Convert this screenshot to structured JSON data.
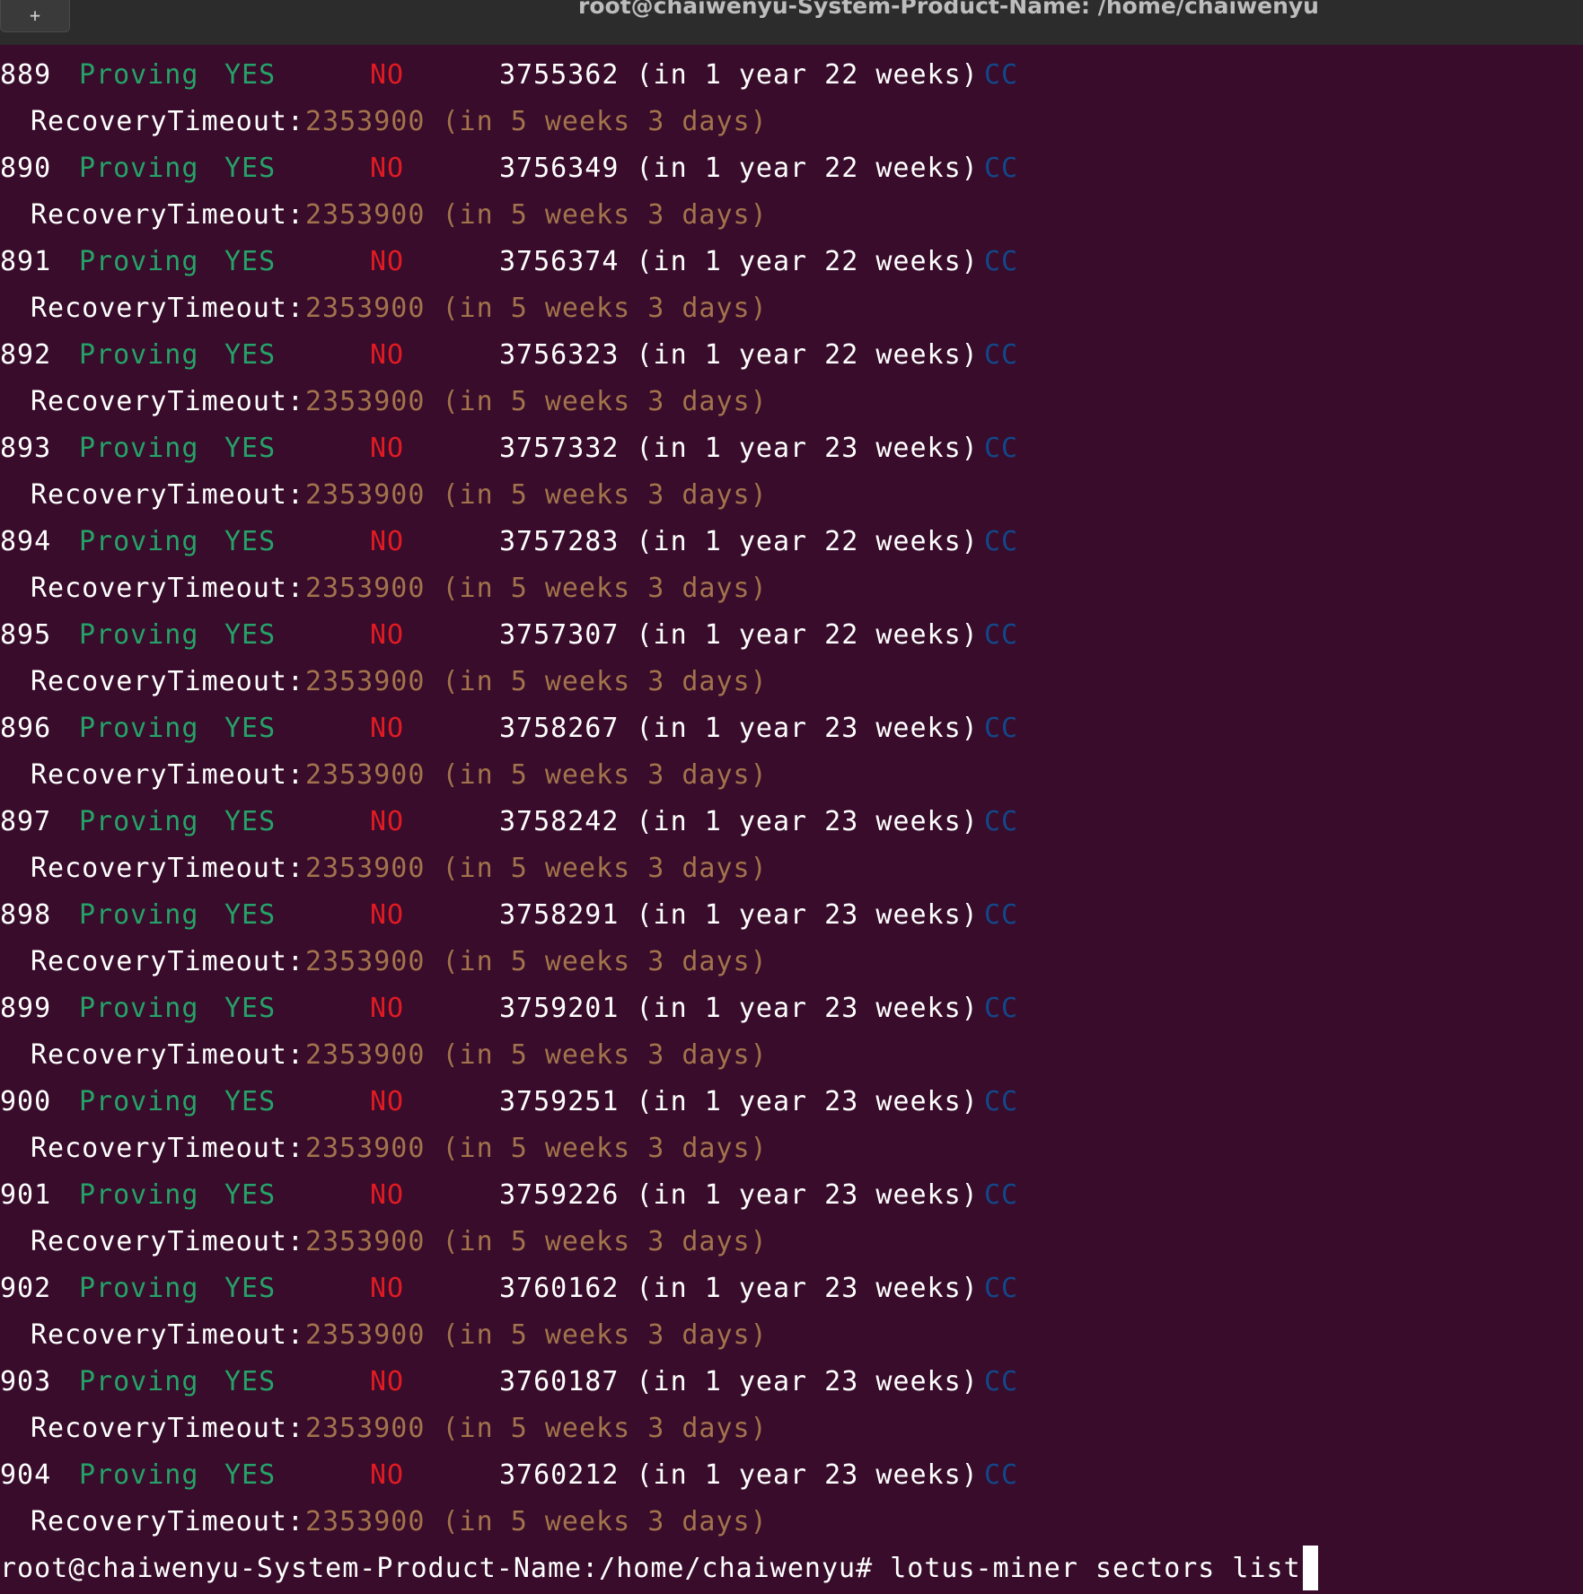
{
  "window": {
    "title": "root@chaiwenyu-System-Product-Name: /home/chaiwenyu",
    "new_tab_label": "+"
  },
  "colors": {
    "background": "#380c2a",
    "titlebar": "#2c2c2c",
    "green": "#26a269",
    "red": "#e01b24",
    "blue": "#12488b",
    "tan": "#a2734c"
  },
  "recovery_label": "RecoveryTimeout:",
  "recovery_value": "2353900 (in 5 weeks 3 days)",
  "sectors": [
    {
      "id": "889",
      "state": "Proving",
      "active": "YES",
      "faulty": "NO",
      "expiration": "3755362 (in 1 year 22 weeks)",
      "deals": "CC"
    },
    {
      "id": "890",
      "state": "Proving",
      "active": "YES",
      "faulty": "NO",
      "expiration": "3756349 (in 1 year 22 weeks)",
      "deals": "CC"
    },
    {
      "id": "891",
      "state": "Proving",
      "active": "YES",
      "faulty": "NO",
      "expiration": "3756374 (in 1 year 22 weeks)",
      "deals": "CC"
    },
    {
      "id": "892",
      "state": "Proving",
      "active": "YES",
      "faulty": "NO",
      "expiration": "3756323 (in 1 year 22 weeks)",
      "deals": "CC"
    },
    {
      "id": "893",
      "state": "Proving",
      "active": "YES",
      "faulty": "NO",
      "expiration": "3757332 (in 1 year 23 weeks)",
      "deals": "CC"
    },
    {
      "id": "894",
      "state": "Proving",
      "active": "YES",
      "faulty": "NO",
      "expiration": "3757283 (in 1 year 22 weeks)",
      "deals": "CC"
    },
    {
      "id": "895",
      "state": "Proving",
      "active": "YES",
      "faulty": "NO",
      "expiration": "3757307 (in 1 year 22 weeks)",
      "deals": "CC"
    },
    {
      "id": "896",
      "state": "Proving",
      "active": "YES",
      "faulty": "NO",
      "expiration": "3758267 (in 1 year 23 weeks)",
      "deals": "CC"
    },
    {
      "id": "897",
      "state": "Proving",
      "active": "YES",
      "faulty": "NO",
      "expiration": "3758242 (in 1 year 23 weeks)",
      "deals": "CC"
    },
    {
      "id": "898",
      "state": "Proving",
      "active": "YES",
      "faulty": "NO",
      "expiration": "3758291 (in 1 year 23 weeks)",
      "deals": "CC"
    },
    {
      "id": "899",
      "state": "Proving",
      "active": "YES",
      "faulty": "NO",
      "expiration": "3759201 (in 1 year 23 weeks)",
      "deals": "CC"
    },
    {
      "id": "900",
      "state": "Proving",
      "active": "YES",
      "faulty": "NO",
      "expiration": "3759251 (in 1 year 23 weeks)",
      "deals": "CC"
    },
    {
      "id": "901",
      "state": "Proving",
      "active": "YES",
      "faulty": "NO",
      "expiration": "3759226 (in 1 year 23 weeks)",
      "deals": "CC"
    },
    {
      "id": "902",
      "state": "Proving",
      "active": "YES",
      "faulty": "NO",
      "expiration": "3760162 (in 1 year 23 weeks)",
      "deals": "CC"
    },
    {
      "id": "903",
      "state": "Proving",
      "active": "YES",
      "faulty": "NO",
      "expiration": "3760187 (in 1 year 23 weeks)",
      "deals": "CC"
    },
    {
      "id": "904",
      "state": "Proving",
      "active": "YES",
      "faulty": "NO",
      "expiration": "3760212 (in 1 year 23 weeks)",
      "deals": "CC"
    }
  ],
  "prompt": {
    "text": "root@chaiwenyu-System-Product-Name:/home/chaiwenyu#",
    "command": "lotus-miner sectors list"
  }
}
